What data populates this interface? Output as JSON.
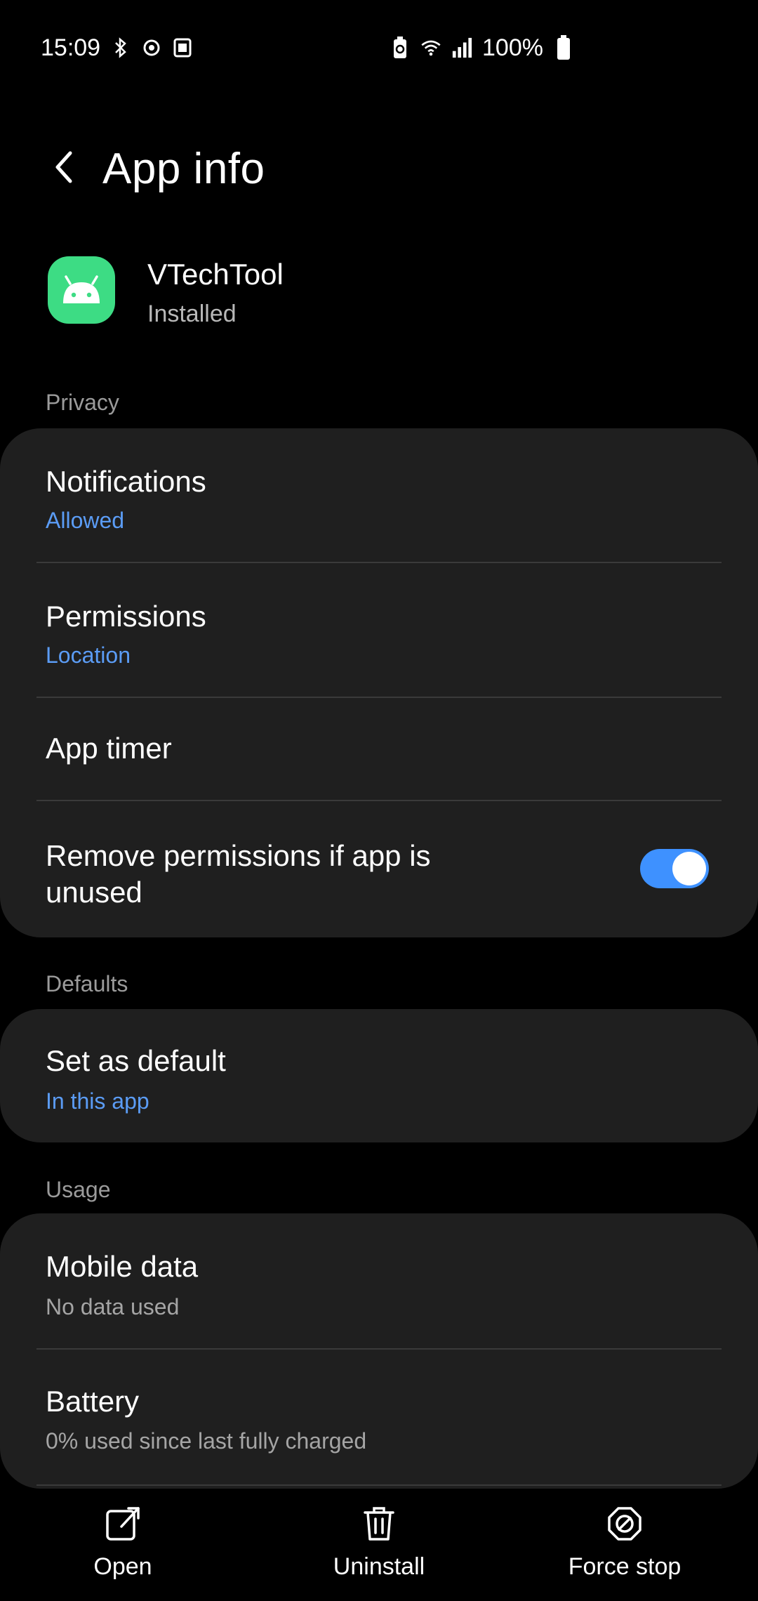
{
  "status_bar": {
    "time": "15:09",
    "battery": "100%"
  },
  "header": {
    "title": "App info"
  },
  "app": {
    "name": "VTechTool",
    "status": "Installed"
  },
  "sections": {
    "privacy": "Privacy",
    "defaults": "Defaults",
    "usage": "Usage"
  },
  "privacy_rows": {
    "notifications_title": "Notifications",
    "notifications_sub": "Allowed",
    "permissions_title": "Permissions",
    "permissions_sub": "Location",
    "app_timer_title": "App timer",
    "remove_permissions_line1": "Remove permissions if app is",
    "remove_permissions_line2": "unused"
  },
  "defaults_rows": {
    "set_default_title": "Set as default",
    "set_default_sub": "In this app"
  },
  "usage_rows": {
    "mobile_data_title": "Mobile data",
    "mobile_data_sub": "No data used",
    "battery_title": "Battery",
    "battery_sub": "0% used since last fully charged"
  },
  "bottom_bar": {
    "open": "Open",
    "uninstall": "Uninstall",
    "force_stop": "Force stop"
  },
  "colors": {
    "background": "#000000",
    "card": "#1f1f1f",
    "accent_blue": "#5b9cf5",
    "toggle_on": "#3e91ff",
    "android_green": "#3ddc84"
  },
  "toggle": {
    "remove_permissions_if_unused": true
  }
}
